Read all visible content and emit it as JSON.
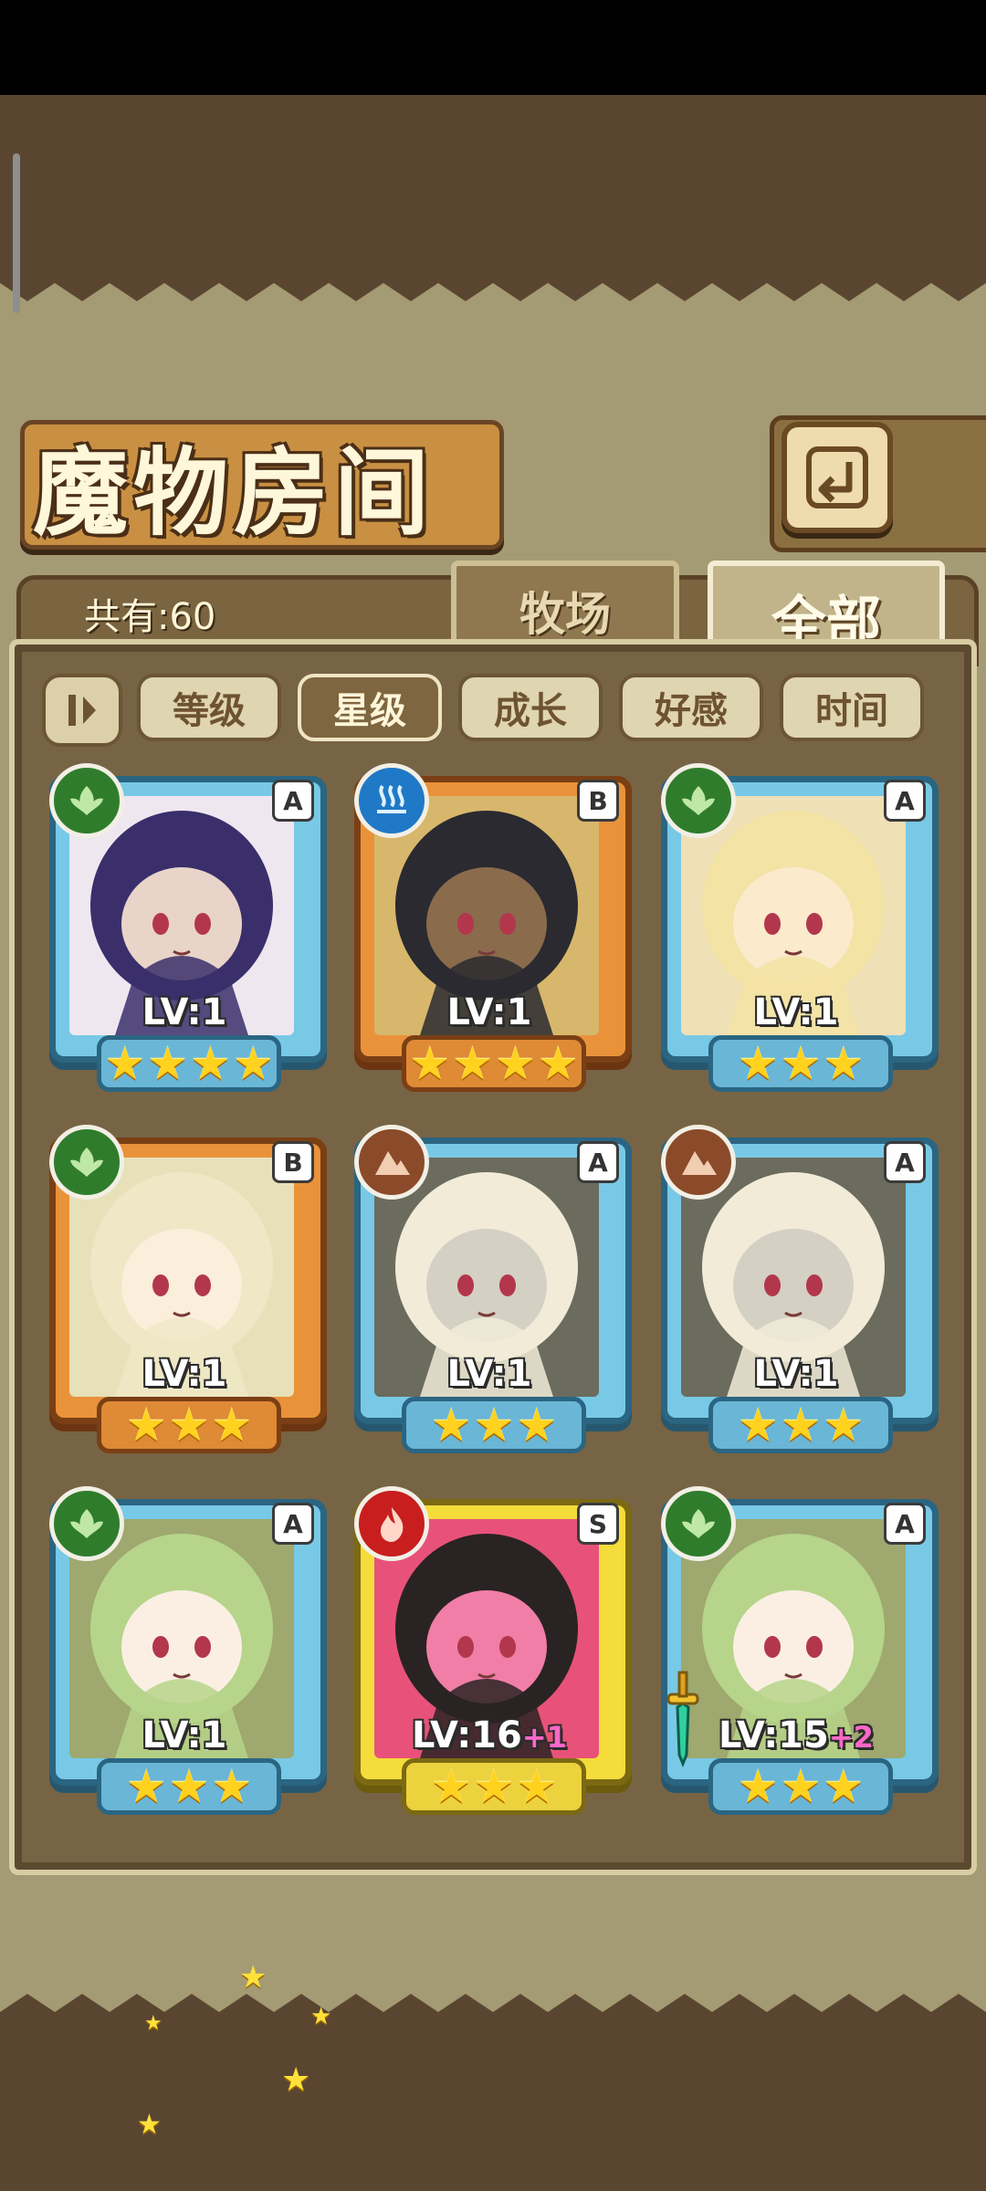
{
  "title": "魔物房间",
  "count_label": "共有:60",
  "tabs": {
    "ranch": "牧场",
    "all": "全部",
    "active": "all"
  },
  "filters": [
    {
      "label": "等级",
      "active": false
    },
    {
      "label": "星级",
      "active": true
    },
    {
      "label": "成长",
      "active": false
    },
    {
      "label": "好感",
      "active": false
    },
    {
      "label": "时间",
      "active": false
    }
  ],
  "colors": {
    "frame_blue": "#78c9e6",
    "frame_orange": "#e9923a",
    "frame_yellow": "#f4dc3b",
    "star": "#ffd21f",
    "plus": "#ff67c9"
  },
  "monsters": [
    {
      "element": "leaf",
      "rank": "A",
      "frame": "blue",
      "level": "LV:1",
      "plus": "",
      "stars": 4,
      "icon": "leaf-icon",
      "art": "purple-hair-hooded-girl"
    },
    {
      "element": "water",
      "rank": "B",
      "frame": "orange",
      "level": "LV:1",
      "plus": "",
      "stars": 4,
      "icon": "wave-icon",
      "art": "dark-hair-pharaoh-girl"
    },
    {
      "element": "leaf",
      "rank": "A",
      "frame": "blue",
      "level": "LV:1",
      "plus": "",
      "stars": 3,
      "icon": "leaf-icon",
      "art": "blonde-crying-girl"
    },
    {
      "element": "leaf",
      "rank": "B",
      "frame": "orange",
      "level": "LV:1",
      "plus": "",
      "stars": 3,
      "icon": "leaf-icon",
      "art": "leaf-fairy-girl"
    },
    {
      "element": "earth",
      "rank": "A",
      "frame": "blue",
      "level": "LV:1",
      "plus": "",
      "stars": 3,
      "icon": "mountain-icon",
      "art": "armored-white-hair-girl"
    },
    {
      "element": "earth",
      "rank": "A",
      "frame": "blue",
      "level": "LV:1",
      "plus": "",
      "stars": 3,
      "icon": "mountain-icon",
      "art": "armored-white-hair-girl"
    },
    {
      "element": "leaf",
      "rank": "A",
      "frame": "blue",
      "level": "LV:1",
      "plus": "",
      "stars": 3,
      "icon": "leaf-icon",
      "art": "lotus-leaf-girl"
    },
    {
      "element": "fire",
      "rank": "S",
      "frame": "yellow",
      "level": "LV:16",
      "plus": "+1",
      "stars": 3,
      "icon": "flame-icon",
      "art": "pink-flower-girl"
    },
    {
      "element": "leaf",
      "rank": "A",
      "frame": "blue",
      "level": "LV:15",
      "plus": "+2",
      "stars": 3,
      "icon": "leaf-icon",
      "art": "lotus-leaf-girl",
      "equipped": "sword-icon"
    }
  ]
}
